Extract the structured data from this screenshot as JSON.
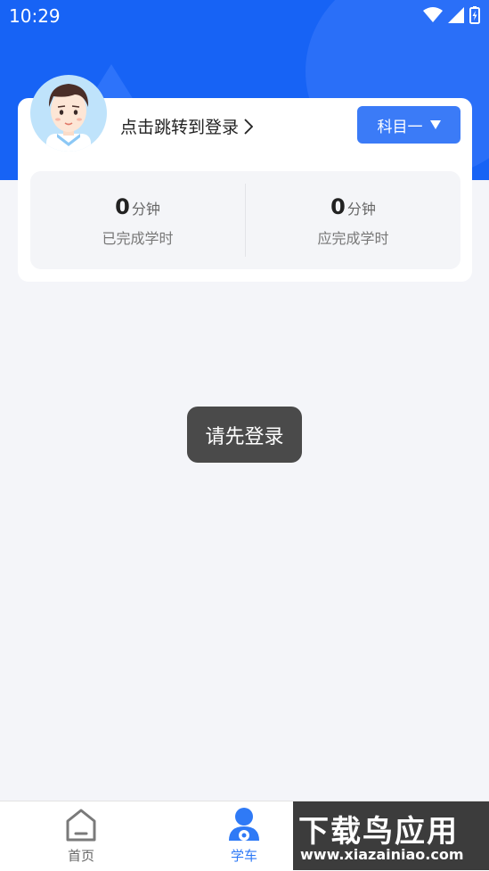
{
  "status_bar": {
    "time": "10:29"
  },
  "profile": {
    "login_prompt": "点击跳转到登录",
    "subject_button": "科目一"
  },
  "stats": [
    {
      "value": "0",
      "unit": "分钟",
      "label": "已完成学时"
    },
    {
      "value": "0",
      "unit": "分钟",
      "label": "应完成学时"
    }
  ],
  "toast": {
    "message": "请先登录"
  },
  "tabbar": {
    "tabs": [
      {
        "label": "首页",
        "active": false
      },
      {
        "label": "学车",
        "active": true
      }
    ]
  },
  "watermark": {
    "title": "下载鸟应用",
    "url": "www.xiazainiao.com"
  },
  "colors": {
    "header": "#1763f5",
    "accent": "#2f7af6",
    "toast": "#4a4a4a"
  }
}
